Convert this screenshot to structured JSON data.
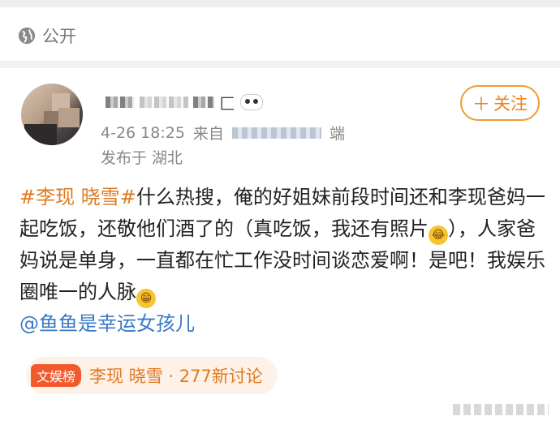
{
  "visibility": {
    "icon": "globe-icon",
    "label": "公开"
  },
  "author": {
    "avatar": "avatar",
    "nickname_tail": "匚"
  },
  "meta": {
    "date_time": "4-26 18:25",
    "source_prefix": "来自",
    "source_suffix": "端",
    "location": "发布于 湖北"
  },
  "follow": {
    "label": "关注",
    "icon": "plus-icon"
  },
  "post": {
    "topic": "#李现 晓雪#",
    "text_1": "什么热搜，俺的好姐妹前段时间还和李现爸妈一起吃饭，还敬他们酒了的（真吃饭，我还有照片",
    "text_2": "），人家爸妈说是单身，一直都在忙工作没时间谈恋爱啊！是吧！我娱乐圈唯一的人脉",
    "mention": "@鱼鱼是幸运女孩儿",
    "emoji_laugh": "😂",
    "emoji_grin": "😁"
  },
  "hot_topic": {
    "badge": "文娱榜",
    "text": "李现 晓雪 · 277新讨论"
  },
  "colors": {
    "accent": "#f07f1a",
    "link": "#3a79c4",
    "badge": "#f05a2c"
  }
}
